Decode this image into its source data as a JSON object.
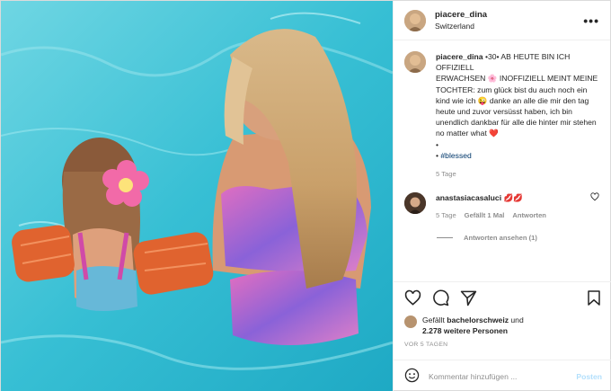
{
  "post": {
    "username": "piacere_dina",
    "location": "Switzerland",
    "more_icon": "more-dots-icon"
  },
  "caption": {
    "username": "piacere_dina",
    "text": "•30• AB HEUTE BIN ICH OFFIZIELL\nERWACHSEN 🌸 INOFFIZIELL MEINT MEINE TOCHTER: zum glück bist du auch noch ein kind wie ich 😜 danke an alle die mir den tag heute und zuvor versüsst haben, ich bin unendlich dankbar für alle die hinter mir stehen no matter what ❤️\n•",
    "hashtag_prefix": "• ",
    "hashtag": "#blessed",
    "time": "5 Tage"
  },
  "comment": {
    "username": "anastasiacasaluci",
    "text": "💋💋",
    "time": "5 Tage",
    "likes": "Gefällt 1 Mal",
    "reply": "Antworten",
    "view_replies": "Antworten ansehen (1)"
  },
  "likes": {
    "prefix": "Gefällt ",
    "user": "bachelorschweiz",
    "suffix": " und",
    "others": "2.278 weitere Personen"
  },
  "timestamp": "VOR 5 TAGEN",
  "add_comment": {
    "placeholder": "Kommentar hinzufügen ...",
    "post_label": "Posten"
  },
  "colors": {
    "pool": "#3ec6d9",
    "link": "#00376b",
    "muted": "#8e8e8e",
    "post_disabled": "#b2dffc"
  }
}
